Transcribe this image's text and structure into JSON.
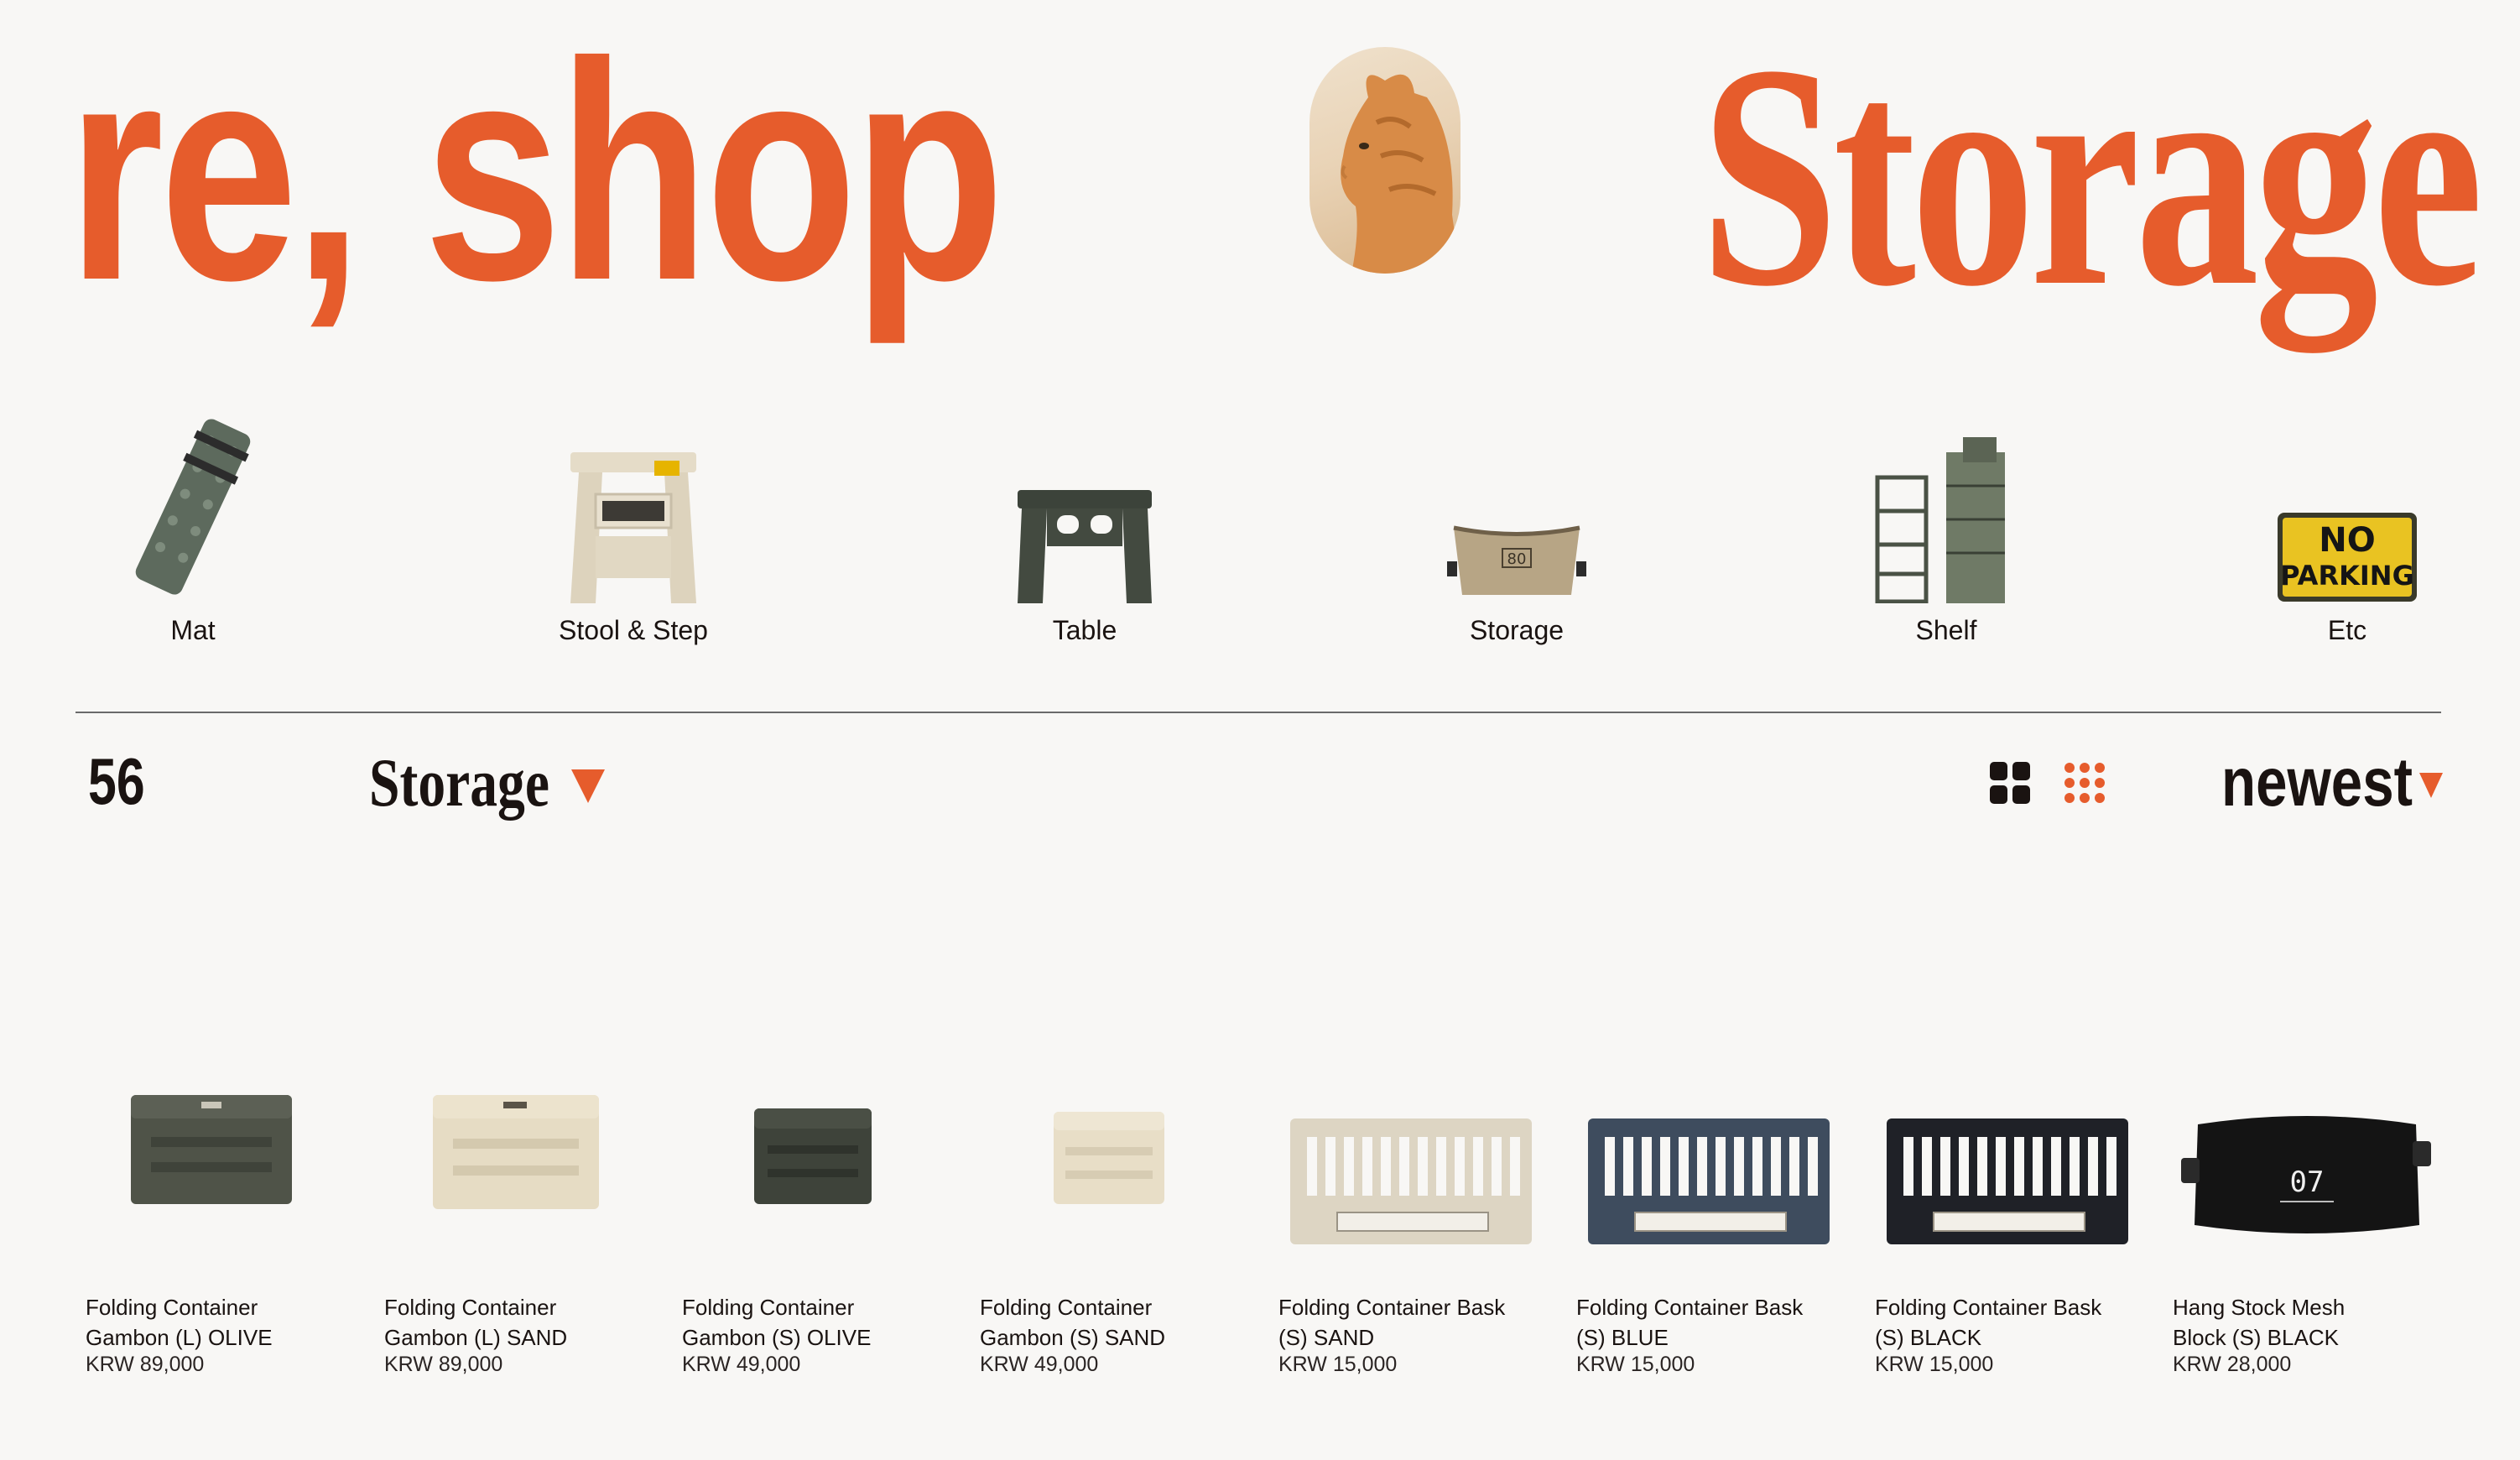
{
  "header": {
    "brand": "re, shop",
    "section_title": "Storage"
  },
  "categories": [
    {
      "label": "Mat",
      "icon": "mat-icon"
    },
    {
      "label": "Stool & Step",
      "icon": "stool-icon"
    },
    {
      "label": "Table",
      "icon": "table-icon"
    },
    {
      "label": "Storage",
      "icon": "storage-bag-icon"
    },
    {
      "label": "Shelf",
      "icon": "shelf-icon"
    },
    {
      "label": "Etc",
      "icon": "no-parking-sign-icon",
      "sign_text": [
        "NO",
        "PARKING"
      ]
    }
  ],
  "toolbar": {
    "count": "56",
    "filter_label": "Storage",
    "sort_label": "newest"
  },
  "products": [
    {
      "name_line1": "Folding Container",
      "name_line2": "Gambon (L) OLIVE",
      "price": "KRW 89,000",
      "color": "#4f5348"
    },
    {
      "name_line1": "Folding Container",
      "name_line2": "Gambon (L) SAND",
      "price": "KRW 89,000",
      "color": "#e6dcc4"
    },
    {
      "name_line1": "Folding Container",
      "name_line2": "Gambon (S) OLIVE",
      "price": "KRW 49,000",
      "color": "#3e433a"
    },
    {
      "name_line1": "Folding Container",
      "name_line2": "Gambon (S) SAND",
      "price": "KRW 49,000",
      "color": "#e8dec7"
    },
    {
      "name_line1": "Folding Container Bask",
      "name_line2": "(S) SAND",
      "price": "KRW 15,000",
      "color": "#ddd5c3"
    },
    {
      "name_line1": "Folding Container Bask",
      "name_line2": "(S) BLUE",
      "price": "KRW 15,000",
      "color": "#3e4c5e"
    },
    {
      "name_line1": "Folding Container Bask",
      "name_line2": "(S) BLACK",
      "price": "KRW 15,000",
      "color": "#1f2127"
    },
    {
      "name_line1": "Hang Stock Mesh",
      "name_line2": "Block (S) BLACK",
      "price": "KRW 28,000",
      "color": "#141414",
      "tag_text": "07"
    }
  ],
  "colors": {
    "accent": "#e65c2c",
    "text": "#1a1311",
    "background": "#f8f7f5"
  }
}
